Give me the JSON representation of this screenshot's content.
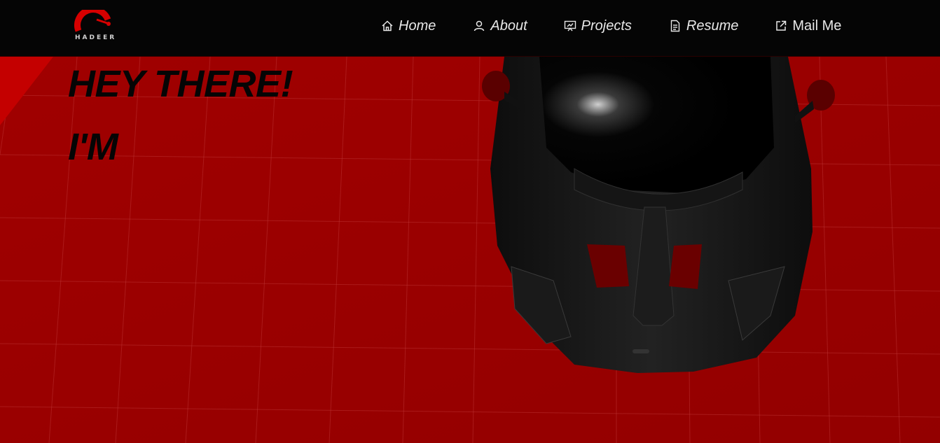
{
  "nav": {
    "logo_text": "HADEER",
    "items": [
      {
        "label": "Home",
        "icon": "home-icon"
      },
      {
        "label": "About",
        "icon": "user-icon"
      },
      {
        "label": "Projects",
        "icon": "presentation-icon"
      },
      {
        "label": "Resume",
        "icon": "document-icon"
      },
      {
        "label": "Mail Me",
        "icon": "external-link-icon"
      }
    ]
  },
  "hero": {
    "line1": "HEY THERE!",
    "line2": "I'M"
  },
  "colors": {
    "nav_bg": "#050505",
    "hero_bg": "#990000",
    "accent": "#d40000",
    "text": "#e8e8e8"
  }
}
